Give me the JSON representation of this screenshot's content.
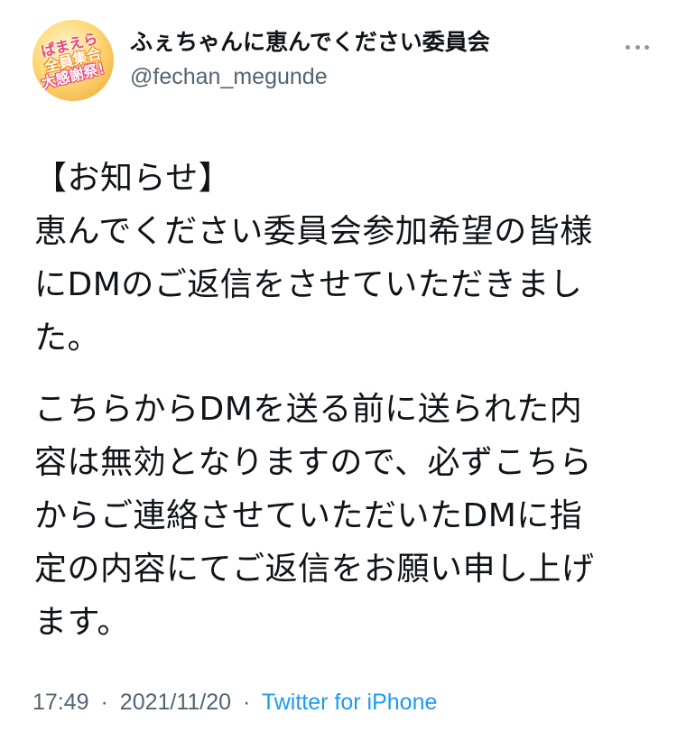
{
  "account": {
    "display_name": "ふぇちゃんに恵んでください委員会",
    "handle": "@fechan_megunde",
    "avatar_text": [
      "ぱまえら",
      "全員集合",
      "大感謝祭！"
    ]
  },
  "tweet": {
    "paragraph1": [
      "【お知らせ】",
      "恵んでください委員会参加希望の皆様",
      "にDMのご返信をさせていただきまし",
      "た。"
    ],
    "paragraph2": [
      "こちらからDMを送る前に送られた内",
      "容は無効となりますので、必ずこちら",
      "からご連絡させていただいたDMに指",
      "定の内容にてご返信をお願い申し上げ",
      "ます。"
    ]
  },
  "meta": {
    "time": "17:49",
    "separator1": "·",
    "date": "2021/11/20",
    "separator2": "·",
    "source": "Twitter for iPhone"
  },
  "icons": {
    "more": "more-horizontal-icon"
  },
  "colors": {
    "text": "#0f1419",
    "secondary": "#536471",
    "link": "#1d9bf0"
  }
}
